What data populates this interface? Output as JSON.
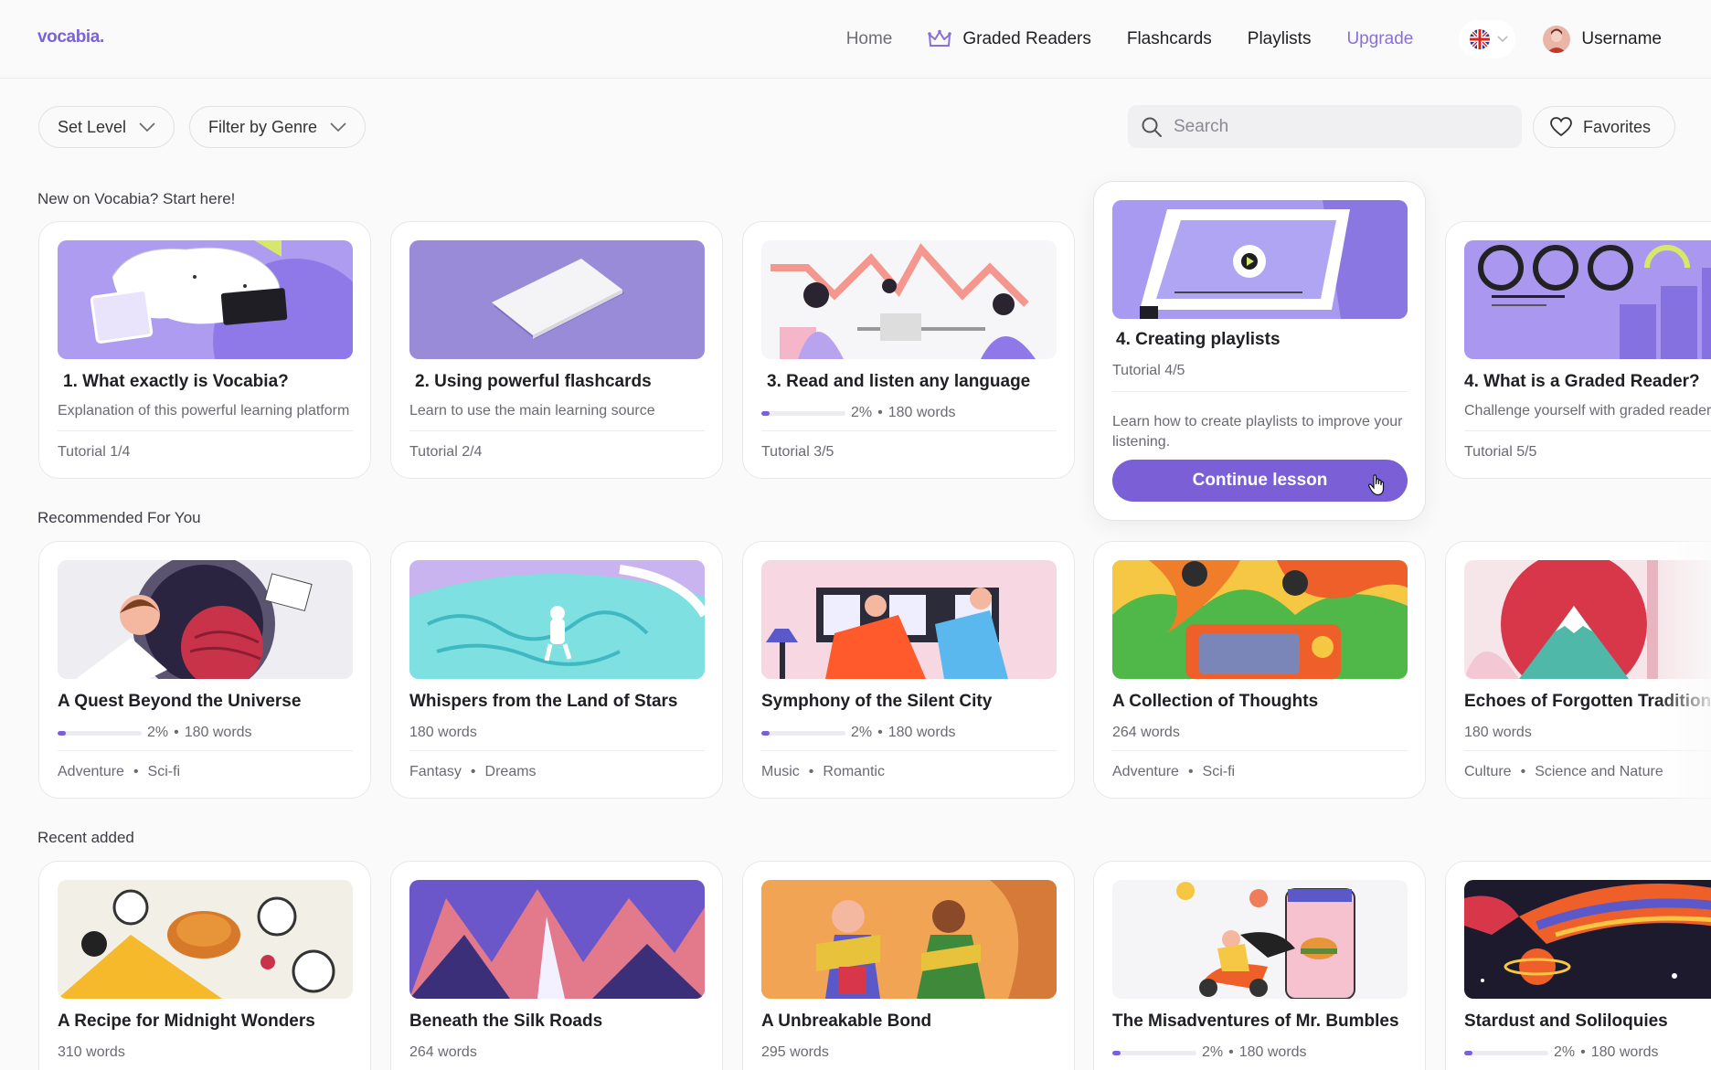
{
  "nav": {
    "logo": "vocabia.",
    "home": "Home",
    "graded_readers": "Graded Readers",
    "flashcards": "Flashcards",
    "playlists": "Playlists",
    "upgrade": "Upgrade",
    "username": "Username"
  },
  "filters": {
    "set_level": "Set Level",
    "filter_genre": "Filter by Genre",
    "search_placeholder": "Search",
    "favorites": "Favorites"
  },
  "sections": {
    "start": "New on Vocabia? Start here!",
    "recommended": "Recommended For You",
    "recent": "Recent added"
  },
  "tutorials": [
    {
      "title": "1. What exactly is Vocabia?",
      "desc": "Explanation of this powerful learning platform",
      "foot": "Tutorial 1/4"
    },
    {
      "title": "2. Using powerful flashcards",
      "desc": "Learn to use the main learning source",
      "foot": "Tutorial 2/4"
    },
    {
      "title": "3. Read and listen any language",
      "pct": "2%",
      "words": "180 words",
      "progress": 0.1,
      "foot": "Tutorial 3/5"
    },
    {
      "title": "4. What is a Graded Reader?",
      "desc": "Challenge yourself with graded readers",
      "foot": "Tutorial 5/5"
    }
  ],
  "expanded": {
    "title": "4. Creating playlists",
    "sub": "Tutorial 4/5",
    "desc": "Learn how to create playlists to improve your listening.",
    "button": "Continue lesson"
  },
  "recommended": [
    {
      "title": "A Quest Beyond the Universe",
      "pct": "2%",
      "words": "180 words",
      "progress": 0.1,
      "tag1": "Adventure",
      "tag2": "Sci-fi"
    },
    {
      "title": "Whispers from the Land of Stars",
      "words": "180 words",
      "tag1": "Fantasy",
      "tag2": "Dreams"
    },
    {
      "title": "Symphony of the Silent City",
      "pct": "2%",
      "words": "180 words",
      "progress": 0.1,
      "tag1": "Music",
      "tag2": "Romantic"
    },
    {
      "title": "A Collection of Thoughts",
      "words": "264 words",
      "tag1": "Adventure",
      "tag2": "Sci-fi"
    },
    {
      "title": "Echoes of Forgotten Traditions",
      "words": "180 words",
      "tag1": "Culture",
      "tag2": "Science and Nature"
    }
  ],
  "recent": [
    {
      "title": "A Recipe for Midnight Wonders",
      "words": "310 words"
    },
    {
      "title": "Beneath the Silk Roads",
      "words": "264 words"
    },
    {
      "title": "A Unbreakable Bond",
      "words": "295 words"
    },
    {
      "title": "The Misadventures of Mr. Bumbles",
      "pct": "2%",
      "words": "180 words",
      "progress": 0.1
    },
    {
      "title": "Stardust and Soliloquies",
      "pct": "2%",
      "words": "180 words",
      "progress": 0.1
    }
  ],
  "colors": {
    "accent": "#7a5fd6",
    "upgrade": "#8b6fd8"
  }
}
